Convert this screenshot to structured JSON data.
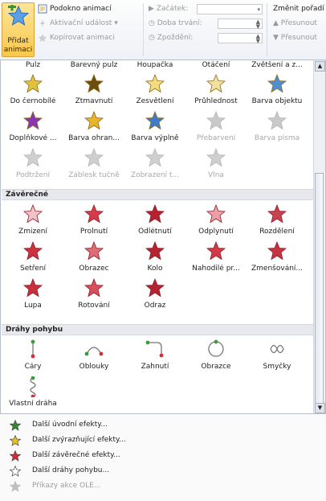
{
  "ribbon": {
    "add_animation_line1": "Přidat",
    "add_animation_line2": "animaci",
    "animation_pane": "Podokno animací",
    "trigger": "Aktivační událost",
    "copy_animation": "Kopírovat animaci",
    "start_label": "Začátek:",
    "duration_label": "Doba trvání:",
    "delay_label": "Zpoždění:",
    "reorder_label": "Změnit pořadí",
    "move_earlier": "Přesunout",
    "move_later": "Přesunout"
  },
  "gallery": {
    "top_labels": [
      "Pulz",
      "Barevný pulz",
      "Houpačka",
      "Otáčení",
      "Zvětšení a z..."
    ],
    "emphasis_rows": [
      [
        {
          "label": "Do černobílé",
          "color": "#e1c23a",
          "disabled": false
        },
        {
          "label": "Ztmavnutí",
          "color": "#6d4d0c",
          "disabled": false
        },
        {
          "label": "Zesvětlení",
          "color": "#f4dc7c",
          "disabled": false
        },
        {
          "label": "Průhlednost",
          "color": "#f2e0a0",
          "disabled": false
        },
        {
          "label": "Barva objektu",
          "color": "#4f8fd6",
          "disabled": false
        }
      ],
      [
        {
          "label": "Doplňkové ...",
          "color": "#8b35b6",
          "disabled": false
        },
        {
          "label": "Barva ohran...",
          "color": "#e8b42a",
          "disabled": false
        },
        {
          "label": "Barva výplně",
          "color": "#3d7cc9",
          "disabled": false
        },
        {
          "label": "Přebarvení",
          "color": "#c9c9c9",
          "disabled": true
        },
        {
          "label": "Barva písma",
          "color": "#c9c9c9",
          "disabled": true
        }
      ],
      [
        {
          "label": "Podtržení",
          "color": "#cfcfcf",
          "disabled": true
        },
        {
          "label": "Záblesk tučně",
          "color": "#cfcfcf",
          "disabled": true
        },
        {
          "label": "Zobrazení t...",
          "color": "#cfcfcf",
          "disabled": true
        },
        {
          "label": "Vlna",
          "color": "#cfcfcf",
          "disabled": true
        }
      ]
    ],
    "exit_title": "Závěrečné",
    "exit_rows": [
      [
        {
          "label": "Zmizení",
          "color": "#f1c3c6"
        },
        {
          "label": "Prolnutí",
          "color": "#d63b4a"
        },
        {
          "label": "Odlétnutí",
          "color": "#b4232f"
        },
        {
          "label": "Odplynutí",
          "color": "#eaa0a6"
        },
        {
          "label": "Rozdělení",
          "color": "#c9424f"
        }
      ],
      [
        {
          "label": "Setření",
          "color": "#cf2f3f"
        },
        {
          "label": "Obrazec",
          "color": "#e06b75"
        },
        {
          "label": "Kolo",
          "color": "#b4232f"
        },
        {
          "label": "Nahodilé pr...",
          "color": "#d23a48"
        },
        {
          "label": "Zmenšování...",
          "color": "#c93240"
        }
      ],
      [
        {
          "label": "Lupa",
          "color": "#c92f3d"
        },
        {
          "label": "Rotování",
          "color": "#d84e5a"
        },
        {
          "label": "Odraz",
          "color": "#b4232f"
        }
      ]
    ],
    "motion_title": "Dráhy pohybu",
    "motion_rows": [
      [
        {
          "label": "Čáry",
          "shape": "line"
        },
        {
          "label": "Oblouky",
          "shape": "arc"
        },
        {
          "label": "Zahnutí",
          "shape": "turn"
        },
        {
          "label": "Obrazce",
          "shape": "circle"
        },
        {
          "label": "Smyčky",
          "shape": "loop"
        }
      ],
      [
        {
          "label": "Vlastní dráha",
          "shape": "custom"
        }
      ]
    ]
  },
  "menu": [
    {
      "label": "Další úvodní efekty...",
      "icon": "entrance-star-icon",
      "color": "#2e8b2e",
      "disabled": false
    },
    {
      "label": "Další zvýrazňující efekty...",
      "icon": "emphasis-star-icon",
      "color": "#f0c020",
      "disabled": false
    },
    {
      "label": "Další závěrečné efekty...",
      "icon": "exit-star-icon",
      "color": "#d42a38",
      "disabled": false
    },
    {
      "label": "Další dráhy pohybu...",
      "icon": "motion-path-star-icon",
      "color": "#ffffff",
      "disabled": false
    },
    {
      "label": "Příkazy akce OLE...",
      "icon": "ole-action-icon",
      "color": "#c0c0c0",
      "disabled": true
    }
  ]
}
